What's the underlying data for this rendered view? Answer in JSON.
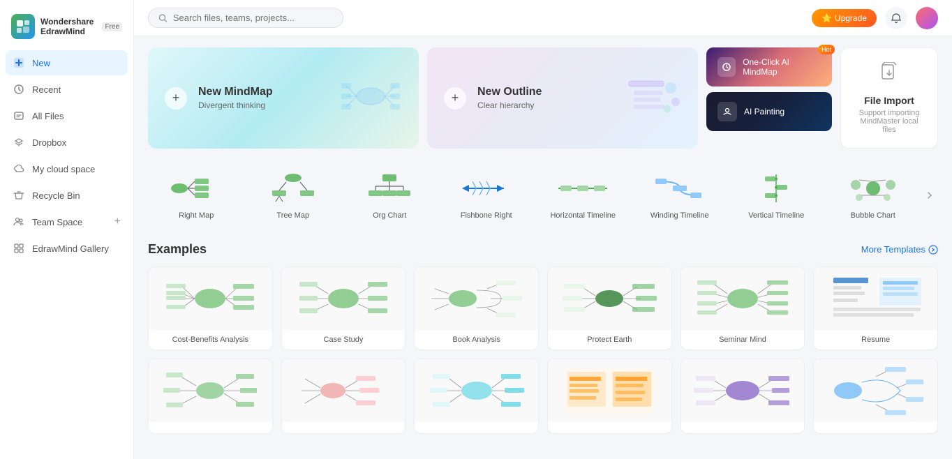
{
  "app": {
    "name": "Wondershare\nEdrawMind",
    "badge": "Free"
  },
  "sidebar": {
    "items": [
      {
        "id": "new",
        "label": "New",
        "icon": "new-icon",
        "active": true
      },
      {
        "id": "recent",
        "label": "Recent",
        "icon": "recent-icon"
      },
      {
        "id": "all-files",
        "label": "All Files",
        "icon": "files-icon"
      },
      {
        "id": "dropbox",
        "label": "Dropbox",
        "icon": "dropbox-icon"
      },
      {
        "id": "my-cloud",
        "label": "My cloud space",
        "icon": "cloud-icon"
      },
      {
        "id": "recycle",
        "label": "Recycle Bin",
        "icon": "recycle-icon"
      },
      {
        "id": "team-space",
        "label": "Team Space",
        "icon": "team-icon",
        "hasAdd": true
      },
      {
        "id": "gallery",
        "label": "EdrawMind Gallery",
        "icon": "gallery-icon"
      }
    ]
  },
  "header": {
    "search_placeholder": "Search files, teams, projects...",
    "upgrade_label": "Upgrade"
  },
  "new_mindmap": {
    "plus": "+",
    "title": "New MindMap",
    "subtitle": "Divergent thinking"
  },
  "new_outline": {
    "plus": "+",
    "title": "New Outline",
    "subtitle": "Clear hierarchy"
  },
  "ai_one_click": {
    "title": "One-Click AI MindMap",
    "badge": "Hot"
  },
  "ai_painting": {
    "title": "AI Painting"
  },
  "file_import": {
    "title": "File Import",
    "subtitle": "Support importing MindMaster local files"
  },
  "chart_types": [
    {
      "label": "Right Map",
      "type": "right-map"
    },
    {
      "label": "Tree Map",
      "type": "tree-map"
    },
    {
      "label": "Org Chart",
      "type": "org-chart"
    },
    {
      "label": "Fishbone Right",
      "type": "fishbone"
    },
    {
      "label": "Horizontal Timeline",
      "type": "h-timeline"
    },
    {
      "label": "Winding Timeline",
      "type": "w-timeline"
    },
    {
      "label": "Vertical Timeline",
      "type": "v-timeline"
    },
    {
      "label": "Bubble Chart",
      "type": "bubble"
    }
  ],
  "examples": {
    "title": "Examples",
    "more_label": "More Templates",
    "row1": [
      {
        "label": "Cost-Benefits Analysis"
      },
      {
        "label": "Case Study"
      },
      {
        "label": "Book Analysis"
      },
      {
        "label": "Protect Earth"
      },
      {
        "label": "Seminar Mind"
      },
      {
        "label": "Resume"
      }
    ],
    "row2": [
      {
        "label": ""
      },
      {
        "label": ""
      },
      {
        "label": ""
      },
      {
        "label": ""
      },
      {
        "label": ""
      },
      {
        "label": ""
      }
    ]
  }
}
